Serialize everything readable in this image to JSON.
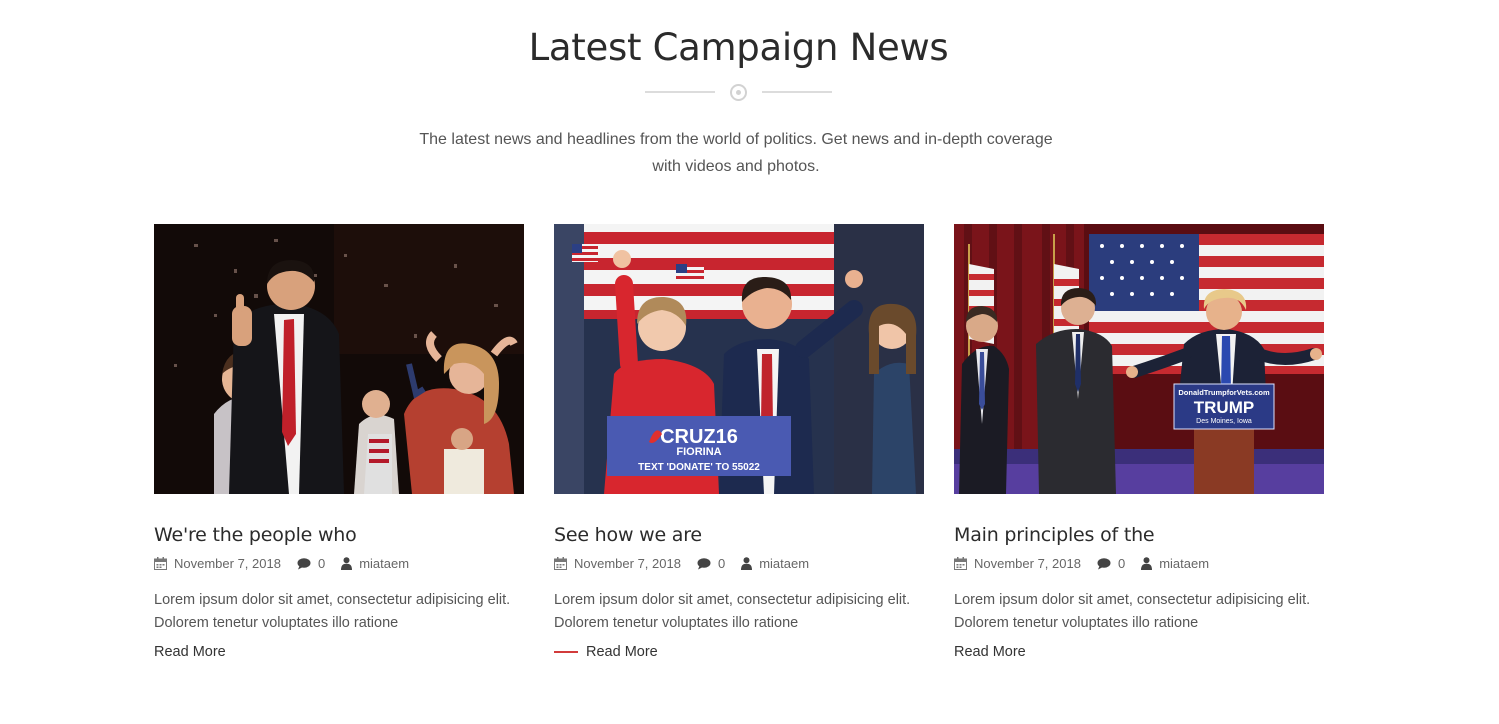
{
  "section": {
    "title": "Latest Campaign News",
    "intro_line1": "The latest news and headlines from the world of politics. Get news and in-depth coverage",
    "intro_line2": "with videos and photos."
  },
  "colors": {
    "accent": "#d23b3b",
    "heading": "#2b2b2b",
    "text": "#555555"
  },
  "icons": {
    "date": "calendar-icon",
    "comments": "comment-icon",
    "author": "user-icon",
    "divider": "circle-dot-icon"
  },
  "posts": [
    {
      "title": "We're the people who",
      "date": "November 7, 2018",
      "comments": "0",
      "author": "miataem",
      "excerpt_line1": "Lorem ipsum dolor sit amet, consectetur adipisicing elit.",
      "excerpt_line2": "Dolorem tenetur voluptates illo ratione",
      "read_more": "Read More"
    },
    {
      "title": "See how we are",
      "date": "November 7, 2018",
      "comments": "0",
      "author": "miataem",
      "excerpt_line1": "Lorem ipsum dolor sit amet, consectetur adipisicing elit.",
      "excerpt_line2": "Dolorem tenetur voluptates illo ratione",
      "read_more": "Read More",
      "photo_sign_line1": "CRUZ16",
      "photo_sign_line2": "FIORINA",
      "photo_sign_line3": "TEXT 'DONATE' TO 55022"
    },
    {
      "title": "Main principles of the",
      "date": "November 7, 2018",
      "comments": "0",
      "author": "miataem",
      "excerpt_line1": "Lorem ipsum dolor sit amet, consectetur adipisicing elit.",
      "excerpt_line2": "Dolorem tenetur voluptates illo ratione",
      "read_more": "Read More",
      "photo_sign_top": "DonaldTrumpforVets.com",
      "photo_sign_main": "TRUMP",
      "photo_sign_sub": "Des Moines, Iowa"
    }
  ]
}
